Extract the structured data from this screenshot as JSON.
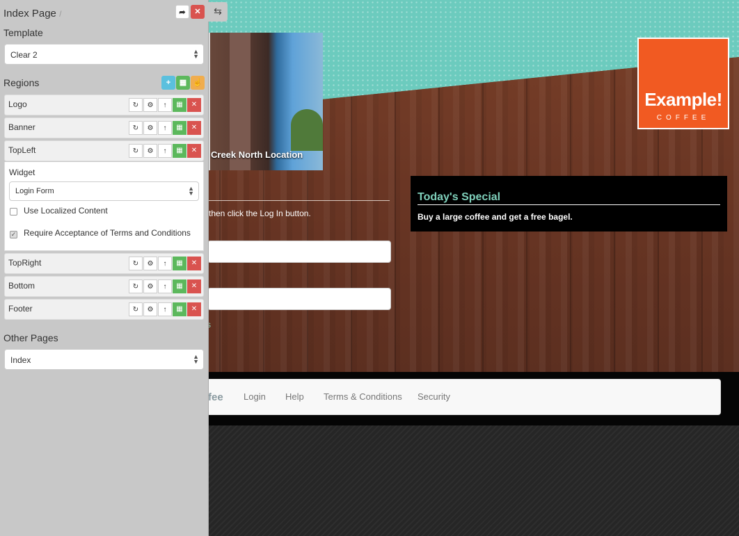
{
  "site": {
    "photo_caption": "Creek North Location",
    "login_instructions": "then click the Log In button.",
    "link_fragment": "s",
    "special_title": "Today's Special",
    "special_body": "Buy a large coffee and get a free bagel.",
    "logo_main": "Example!",
    "logo_sub": "COFFEE",
    "nav_brand_fragment": "fee",
    "nav_links": [
      "Login",
      "Help",
      "Terms & Conditions",
      "Security"
    ]
  },
  "panel": {
    "title": "Index Page",
    "title_sep": "/",
    "template_label": "Template",
    "template_value": "Clear 2",
    "regions_label": "Regions",
    "regions": [
      {
        "name": "Logo"
      },
      {
        "name": "Banner"
      },
      {
        "name": "TopLeft"
      },
      {
        "name": "TopRight"
      },
      {
        "name": "Bottom"
      },
      {
        "name": "Footer"
      }
    ],
    "widget_label": "Widget",
    "widget_value": "Login Form",
    "checkbox_localized": "Use Localized Content",
    "checkbox_localized_checked": false,
    "checkbox_terms": "Require Acceptance of Terms and Conditions",
    "checkbox_terms_checked": true,
    "other_pages_label": "Other Pages",
    "other_pages_value": "Index"
  },
  "icons": {
    "forward": "share-icon",
    "close": "close-icon",
    "toggle": "swap-icon",
    "add": "plus-icon",
    "save": "save-icon",
    "like": "thumbs-up-icon",
    "refresh": "refresh-icon",
    "settings": "gear-icon",
    "up": "arrow-up-icon"
  },
  "colors": {
    "logo": "#f15a22",
    "teal": "#6ccbbe",
    "special_title": "#7fd0bb",
    "danger": "#d9534f",
    "success": "#5cb85c",
    "info": "#5bc0de",
    "warning": "#f0ad4e"
  }
}
